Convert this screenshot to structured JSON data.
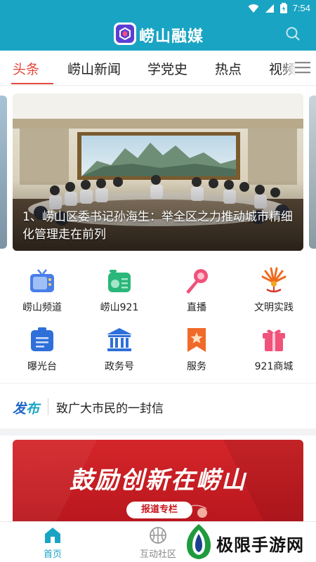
{
  "status_bar": {
    "time": "7:54"
  },
  "header": {
    "app_title": "崂山融媒",
    "icons": {
      "logo": "app-logo-icon",
      "search": "search-icon"
    }
  },
  "tabs": {
    "items": [
      "头条",
      "崂山新闻",
      "学党史",
      "热点",
      "视频"
    ],
    "active_index": 0,
    "menu_icon": "menu-icon"
  },
  "carousel": {
    "caption": "1、崂山区委书记孙海生：举全区之力推动城市精细化管理走在前列"
  },
  "shortcuts": [
    {
      "label": "崂山频道",
      "icon": "tv-icon",
      "color": "#4a7de8"
    },
    {
      "label": "崂山921",
      "icon": "radio-icon",
      "color": "#29b77a"
    },
    {
      "label": "直播",
      "icon": "microphone-icon",
      "color": "#f0527a"
    },
    {
      "label": "文明实践",
      "icon": "civilization-emblem-icon",
      "color": "#f06a1e"
    },
    {
      "label": "曝光台",
      "icon": "document-list-icon",
      "color": "#2f6fd9"
    },
    {
      "label": "政务号",
      "icon": "government-building-icon",
      "color": "#2f6fd9"
    },
    {
      "label": "服务",
      "icon": "bookmark-star-icon",
      "color": "#f06a2a"
    },
    {
      "label": "921商城",
      "icon": "gift-icon",
      "color": "#f0527a"
    }
  ],
  "notice": {
    "badge_part1": "发",
    "badge_part2": "布",
    "text": "致广大市民的一封信"
  },
  "promo": {
    "title": "鼓励创新在崂山",
    "tag": "报道专栏"
  },
  "bottom_nav": [
    {
      "label": "首页",
      "icon": "home-icon",
      "active": true
    },
    {
      "label": "互动社区",
      "icon": "basketball-icon",
      "active": false
    }
  ],
  "watermark": {
    "text": "极限手游网"
  },
  "colors": {
    "accent": "#1aa4c4",
    "tab_active": "#e2483d",
    "promo_red": "#c8161d"
  }
}
